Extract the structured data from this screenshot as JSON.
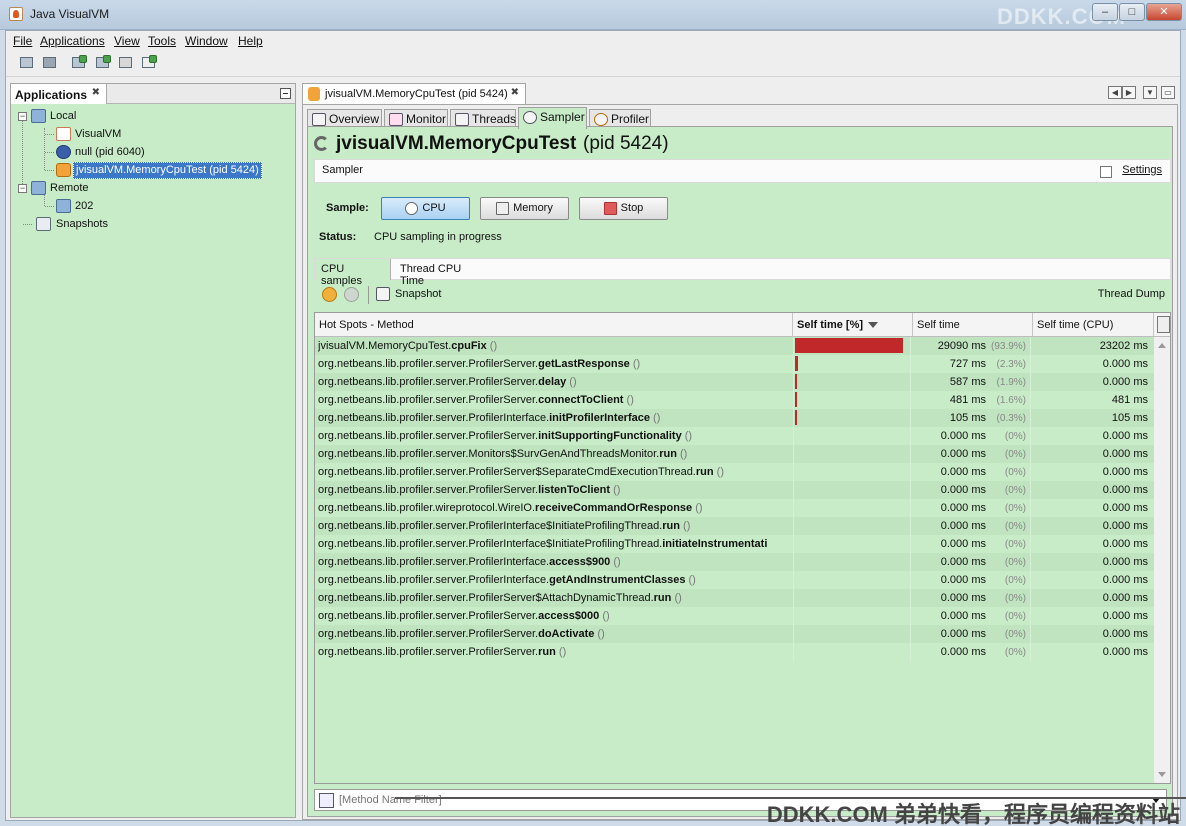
{
  "window": {
    "title": "Java VisualVM",
    "watermark_top": "DDKK.COM",
    "watermark_bottom": "DDKK.COM 弟弟快看，程序员编程资料站"
  },
  "menu": [
    "File",
    "Applications",
    "View",
    "Tools",
    "Window",
    "Help"
  ],
  "left": {
    "tab_label": "Applications",
    "tree": {
      "local": "Local",
      "visualvm": "VisualVM",
      "null_pid": "null (pid 6040)",
      "selected_app": "jvisualVM.MemoryCpuTest (pid 5424)",
      "remote": "Remote",
      "remote_host": "202",
      "snapshots": "Snapshots"
    }
  },
  "main": {
    "doc_tab": "jvisualVM.MemoryCpuTest (pid 5424)",
    "subtabs": [
      "Overview",
      "Monitor",
      "Threads",
      "Sampler",
      "Profiler"
    ],
    "active_subtab": "Sampler",
    "process_name": "jvisualVM.MemoryCpuTest",
    "process_pid": "(pid 5424)",
    "sampler_label": "Sampler",
    "settings_label": "Settings",
    "sample_label": "Sample:",
    "buttons": {
      "cpu": "CPU",
      "memory": "Memory",
      "stop": "Stop"
    },
    "status_label": "Status:",
    "status_value": "CPU sampling in progress",
    "data_tabs": [
      "CPU samples",
      "Thread CPU Time"
    ],
    "snapshot_label": "Snapshot",
    "thread_dump_label": "Thread Dump",
    "columns": [
      "Hot Spots - Method",
      "Self time [%]",
      "Self time",
      "Self time (CPU)"
    ],
    "filter_placeholder": "[Method Name Filter]",
    "rows": [
      {
        "prefix": "jvisualVM.MemoryCpuTest.",
        "method": "cpuFix",
        "pct": 93.9,
        "time": "29090 ms",
        "pct_label": "(93.9%)",
        "cpu": "23202 ms"
      },
      {
        "prefix": "org.netbeans.lib.profiler.server.ProfilerServer.",
        "method": "getLastResponse",
        "pct": 2.3,
        "time": "727 ms",
        "pct_label": "(2.3%)",
        "cpu": "0.000 ms"
      },
      {
        "prefix": "org.netbeans.lib.profiler.server.ProfilerServer.",
        "method": "delay",
        "pct": 1.9,
        "time": "587 ms",
        "pct_label": "(1.9%)",
        "cpu": "0.000 ms"
      },
      {
        "prefix": "org.netbeans.lib.profiler.server.ProfilerServer.",
        "method": "connectToClient",
        "pct": 1.6,
        "time": "481 ms",
        "pct_label": "(1.6%)",
        "cpu": "481 ms"
      },
      {
        "prefix": "org.netbeans.lib.profiler.server.ProfilerInterface.",
        "method": "initProfilerInterface",
        "pct": 0.3,
        "time": "105 ms",
        "pct_label": "(0.3%)",
        "cpu": "105 ms"
      },
      {
        "prefix": "org.netbeans.lib.profiler.server.ProfilerServer.",
        "method": "initSupportingFunctionality",
        "pct": 0,
        "time": "0.000 ms",
        "pct_label": "(0%)",
        "cpu": "0.000 ms"
      },
      {
        "prefix": "org.netbeans.lib.profiler.server.Monitors$SurvGenAndThreadsMonitor.",
        "method": "run",
        "pct": 0,
        "time": "0.000 ms",
        "pct_label": "(0%)",
        "cpu": "0.000 ms"
      },
      {
        "prefix": "org.netbeans.lib.profiler.server.ProfilerServer$SeparateCmdExecutionThread.",
        "method": "run",
        "pct": 0,
        "time": "0.000 ms",
        "pct_label": "(0%)",
        "cpu": "0.000 ms"
      },
      {
        "prefix": "org.netbeans.lib.profiler.server.ProfilerServer.",
        "method": "listenToClient",
        "pct": 0,
        "time": "0.000 ms",
        "pct_label": "(0%)",
        "cpu": "0.000 ms"
      },
      {
        "prefix": "org.netbeans.lib.profiler.wireprotocol.WireIO.",
        "method": "receiveCommandOrResponse",
        "pct": 0,
        "time": "0.000 ms",
        "pct_label": "(0%)",
        "cpu": "0.000 ms"
      },
      {
        "prefix": "org.netbeans.lib.profiler.server.ProfilerInterface$InitiateProfilingThread.",
        "method": "run",
        "pct": 0,
        "time": "0.000 ms",
        "pct_label": "(0%)",
        "cpu": "0.000 ms"
      },
      {
        "prefix": "org.netbeans.lib.profiler.server.ProfilerInterface$InitiateProfilingThread.",
        "method": "initiateInstrumentati",
        "pct": 0,
        "time": "0.000 ms",
        "pct_label": "(0%)",
        "cpu": "0.000 ms",
        "truncated": true
      },
      {
        "prefix": "org.netbeans.lib.profiler.server.ProfilerInterface.",
        "method": "access$900",
        "pct": 0,
        "time": "0.000 ms",
        "pct_label": "(0%)",
        "cpu": "0.000 ms"
      },
      {
        "prefix": "org.netbeans.lib.profiler.server.ProfilerInterface.",
        "method": "getAndInstrumentClasses",
        "pct": 0,
        "time": "0.000 ms",
        "pct_label": "(0%)",
        "cpu": "0.000 ms"
      },
      {
        "prefix": "org.netbeans.lib.profiler.server.ProfilerServer$AttachDynamicThread.",
        "method": "run",
        "pct": 0,
        "time": "0.000 ms",
        "pct_label": "(0%)",
        "cpu": "0.000 ms"
      },
      {
        "prefix": "org.netbeans.lib.profiler.server.ProfilerServer.",
        "method": "access$000",
        "pct": 0,
        "time": "0.000 ms",
        "pct_label": "(0%)",
        "cpu": "0.000 ms"
      },
      {
        "prefix": "org.netbeans.lib.profiler.server.ProfilerServer.",
        "method": "doActivate",
        "pct": 0,
        "time": "0.000 ms",
        "pct_label": "(0%)",
        "cpu": "0.000 ms"
      },
      {
        "prefix": "org.netbeans.lib.profiler.server.ProfilerServer.",
        "method": "run",
        "pct": 0,
        "time": "0.000 ms",
        "pct_label": "(0%)",
        "cpu": "0.000 ms"
      }
    ]
  },
  "colors": {
    "panel_bg": "#c8ebc8",
    "bar": "#c0282a",
    "selection": "#3b78c9"
  }
}
